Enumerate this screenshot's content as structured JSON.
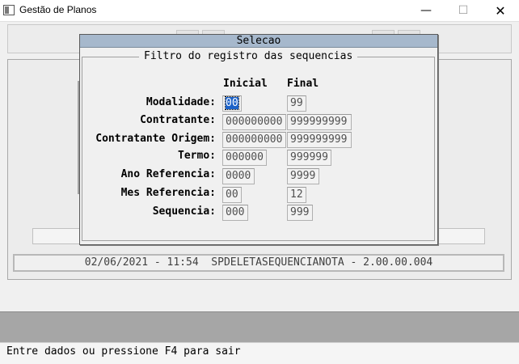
{
  "window": {
    "title": "Gestão de Planos",
    "controls": {
      "minimize": "—",
      "maximize": "☐",
      "close": "✕"
    }
  },
  "info_bar": {
    "text": "02/06/2021 - 11:54  SPDELETASEQUENCIANOTA - 2.00.00.004"
  },
  "status_bar": {
    "text": "Entre dados ou pressione F4 para sair"
  },
  "dialog": {
    "title": "Selecao",
    "group_title": "Filtro do registro das sequencias",
    "columns": {
      "initial": "Inicial",
      "final": "Final"
    },
    "rows": [
      {
        "label": "Modalidade:",
        "initial": "00",
        "final": "99"
      },
      {
        "label": "Contratante:",
        "initial": "000000000",
        "final": "999999999"
      },
      {
        "label": "Contratante Origem:",
        "initial": "000000000",
        "final": "999999999"
      },
      {
        "label": "Termo:",
        "initial": "000000",
        "final": "999999"
      },
      {
        "label": "Ano Referencia:",
        "initial": "0000",
        "final": "9999"
      },
      {
        "label": "Mes Referencia:",
        "initial": "00",
        "final": "12"
      },
      {
        "label": "Sequencia:",
        "initial": "000",
        "final": "999"
      }
    ]
  },
  "colors": {
    "dialog_title_bg": "#a6b8cc",
    "selection": "#1c62c8",
    "bottom_bar": "#a6a6a6"
  }
}
